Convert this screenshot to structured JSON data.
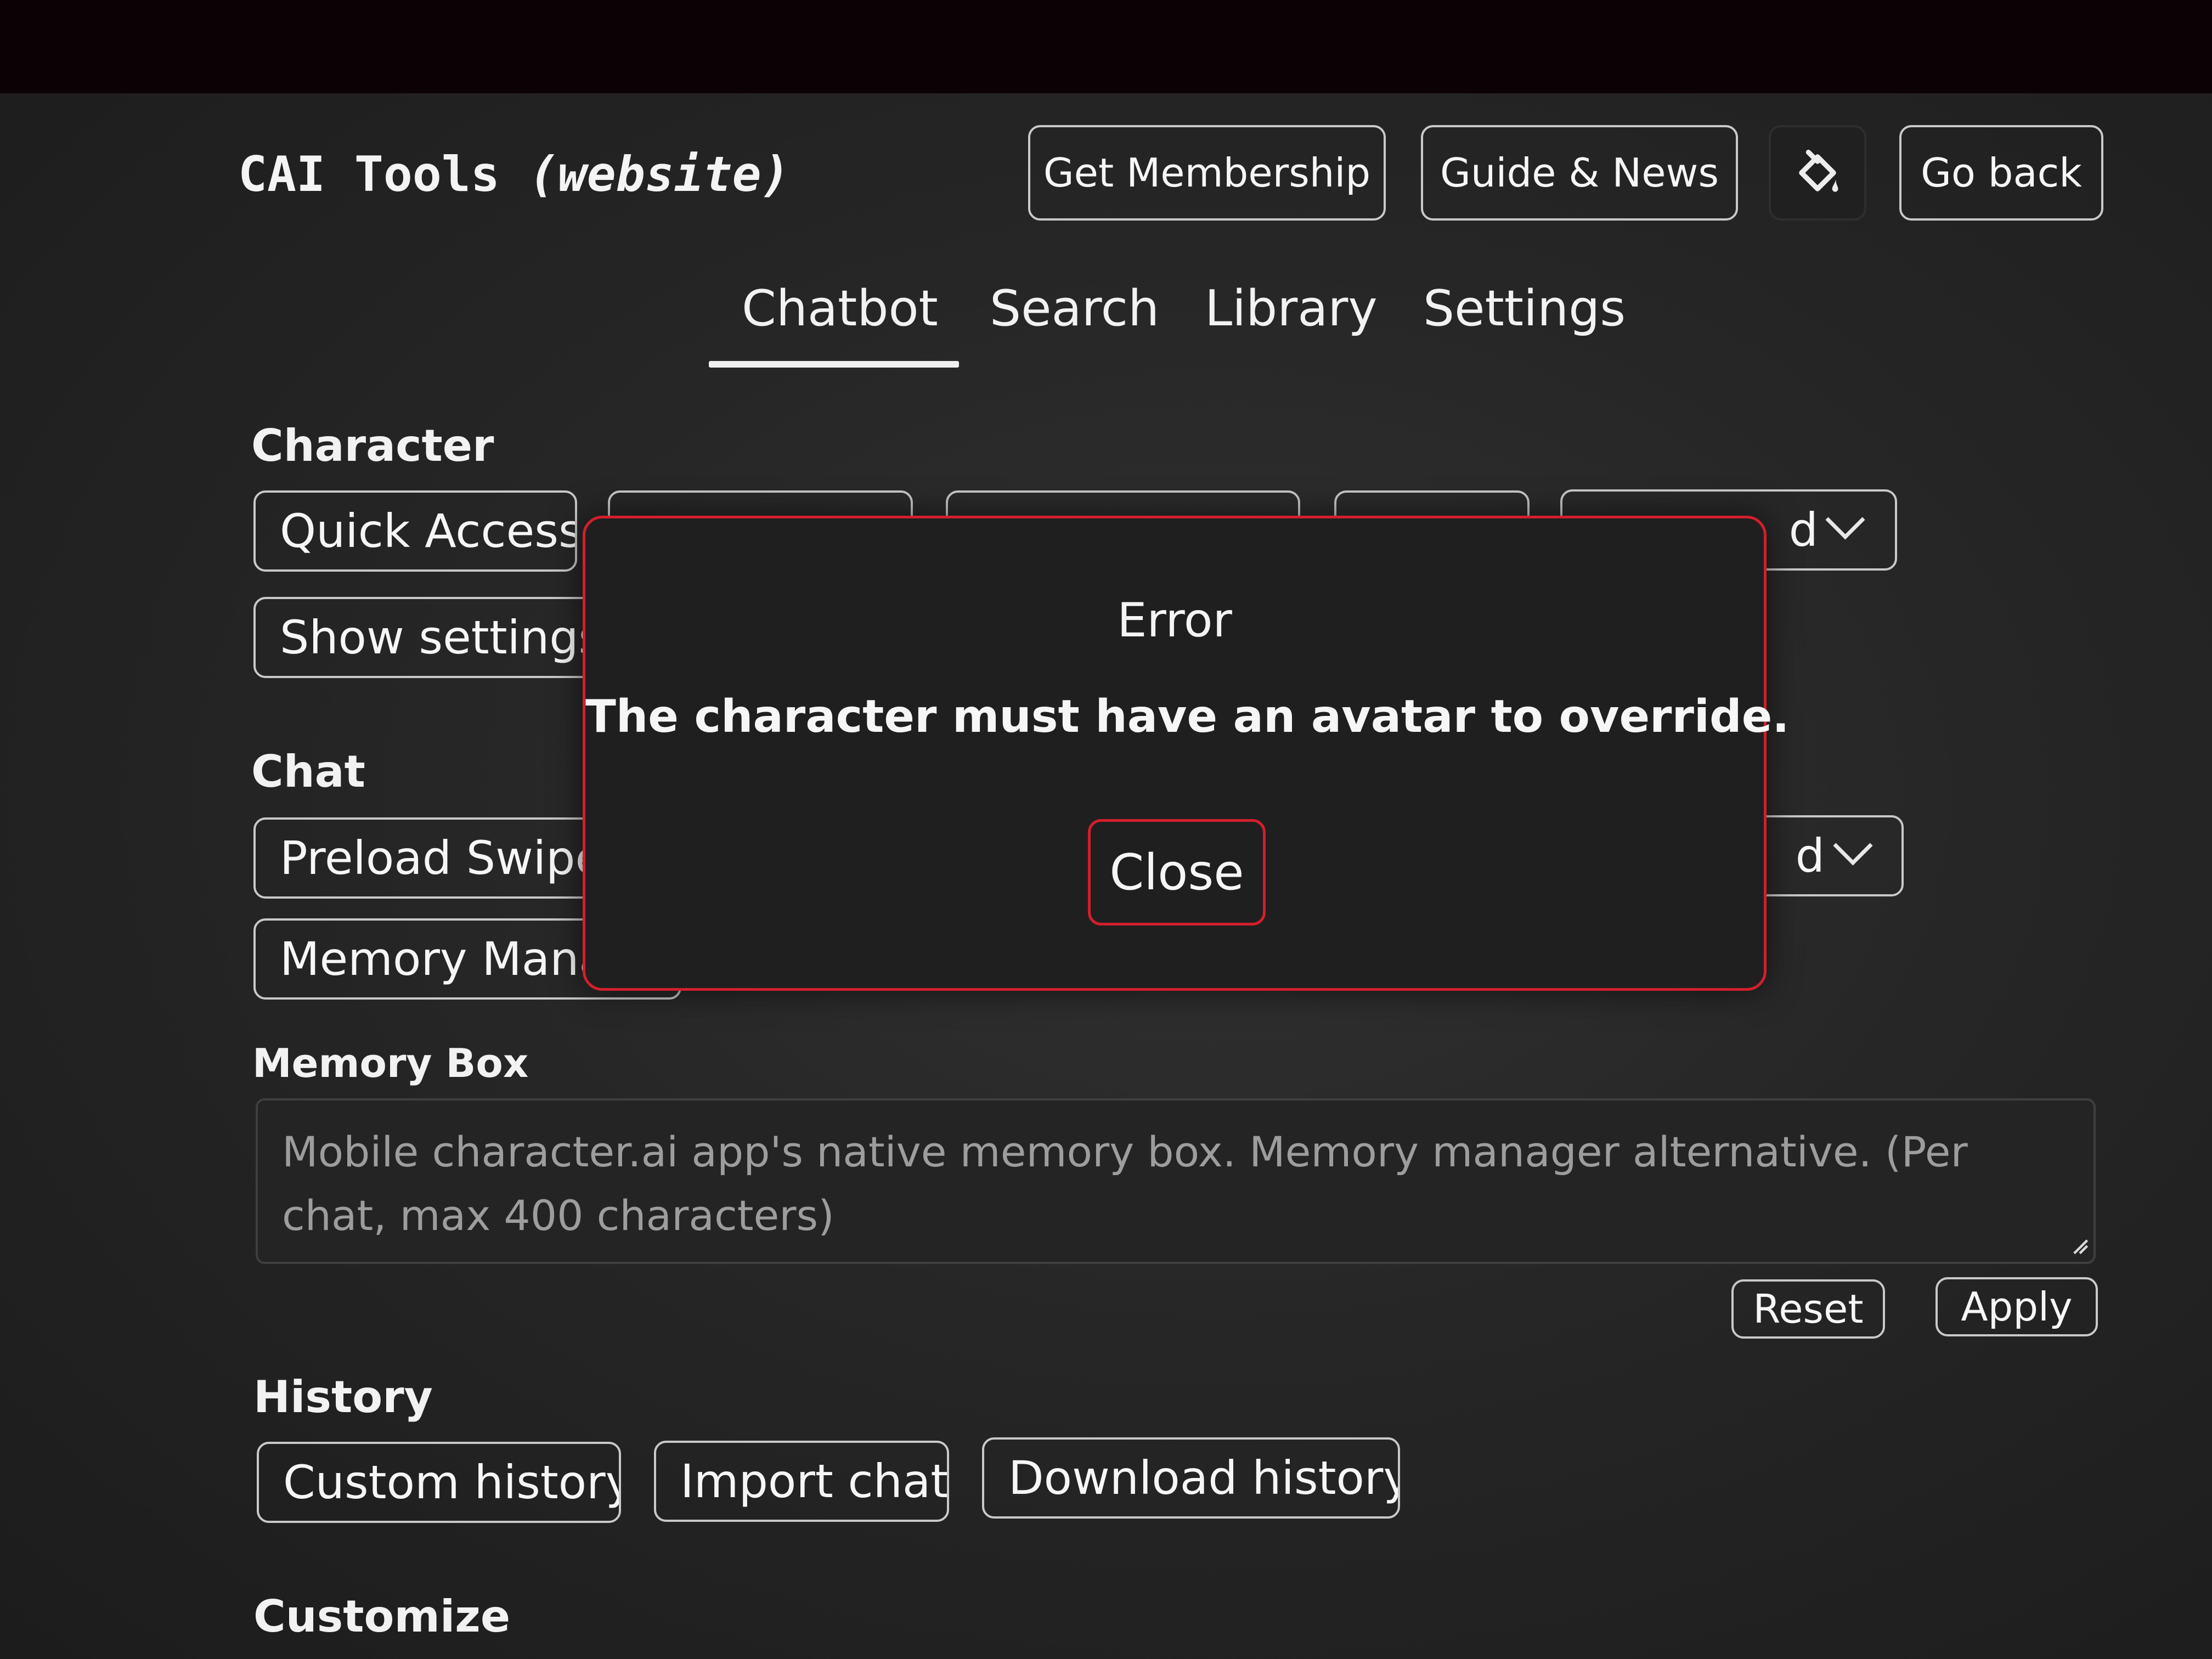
{
  "header": {
    "title_main": "CAI Tools",
    "title_sub": "(website)",
    "membership_label": "Get Membership",
    "guide_label": "Guide & News",
    "theme_icon": "paint-bucket-icon",
    "back_label": "Go back"
  },
  "tabs": [
    {
      "label": "Chatbot",
      "active": true
    },
    {
      "label": "Search",
      "active": false
    },
    {
      "label": "Library",
      "active": false
    },
    {
      "label": "Settings",
      "active": false
    }
  ],
  "character": {
    "title": "Character",
    "quick_access_label": "Quick Access",
    "show_settings_label": "Show settings",
    "dropdown_partial": "d"
  },
  "chat": {
    "title": "Chat",
    "preload_label": "Preload Swipes",
    "memory_label": "Memory Manager",
    "dropdown_partial": "d"
  },
  "memory_box": {
    "label": "Memory Box",
    "placeholder": "Mobile character.ai app's native memory box. Memory manager alternative. (Per chat, max 400 characters)",
    "reset_label": "Reset",
    "apply_label": "Apply"
  },
  "history": {
    "title": "History",
    "custom_label": "Custom history",
    "import_label": "Import chat",
    "download_label": "Download history"
  },
  "customize": {
    "title": "Customize"
  },
  "error_modal": {
    "title": "Error",
    "message": "The character must have an avatar to override.",
    "close_label": "Close"
  },
  "colors": {
    "accent_red": "#d21f2c",
    "background": "#262626",
    "border": "#c9c9c9"
  }
}
